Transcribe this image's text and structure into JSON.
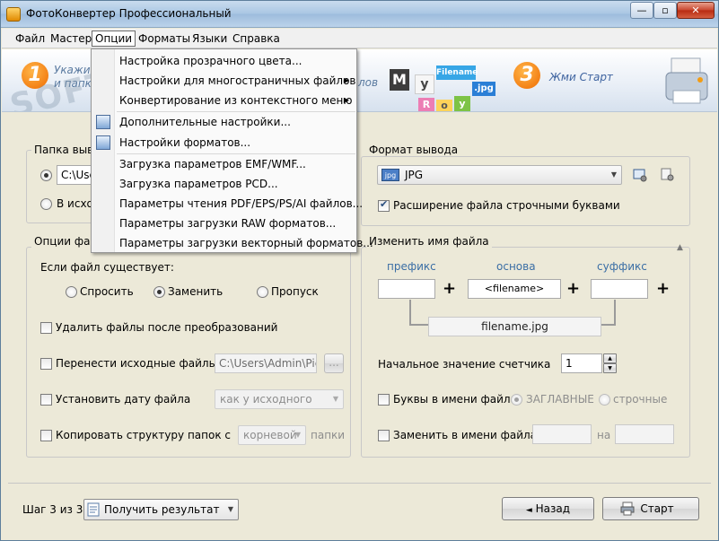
{
  "window": {
    "title": "ФотоКонвертер Профессиональный",
    "minimize": "—",
    "maximize": "▫",
    "close": "✕"
  },
  "menu": [
    "Файл",
    "Мастер",
    "Опции",
    "Форматы",
    "Языки",
    "Справка"
  ],
  "banner": {
    "step1": "1",
    "step1_text_line1": "Укажи",
    "step1_text_line2": "и папк",
    "step2_text": "лов",
    "step3": "3",
    "step3_text": "Жми Старт",
    "tiles": [
      "M",
      "y",
      "Filename",
      ".jpg",
      "R",
      "o",
      "y"
    ]
  },
  "options_menu": {
    "items": [
      {
        "label": "Настройка прозрачного цвета...",
        "submenu": false
      },
      {
        "label": "Настройки для многостраничных файлов",
        "submenu": true
      },
      {
        "label": "Конвертирование из контекстного меню",
        "submenu": true
      },
      {
        "label": "Дополнительные настройки...",
        "submenu": false
      },
      {
        "label": "Настройки форматов...",
        "submenu": false
      },
      {
        "label": "Загрузка параметров EMF/WMF...",
        "submenu": false
      },
      {
        "label": "Загрузка параметров PCD...",
        "submenu": false
      },
      {
        "label": "Параметры чтения PDF/EPS/PS/AI файлов...",
        "submenu": false
      },
      {
        "label": "Параметры загрузки RAW форматов...",
        "submenu": false
      },
      {
        "label": "Параметры загрузки векторный форматов...",
        "submenu": false
      }
    ]
  },
  "output_folder": {
    "title": "Папка выво",
    "path_value": "C:\\Use",
    "radio2_label": "В исходн"
  },
  "output_format": {
    "title": "Формат вывода",
    "format_value": "JPG",
    "format_icon_text": "jpg",
    "lowercase_ext_label": "Расширение файла строчными буквами",
    "lowercase_ext_checked": true
  },
  "file_options": {
    "title": "Опции фай",
    "if_exists_label": "Если файл существует:",
    "if_exists_options": [
      "Спросить",
      "Заменить",
      "Пропуск"
    ],
    "if_exists_selected": "Заменить",
    "delete_after_label": "Удалить файлы после преобразований",
    "move_sources_label": "Перенести исходные файлы",
    "move_path_value": "C:\\Users\\Admin\\Pic",
    "browse_label": "...",
    "set_date_label": "Установить дату файла",
    "set_date_value": "как у исходного",
    "copy_structure_label": "Копировать структуру папок с",
    "copy_structure_value": "корневой",
    "copy_structure_suffix": "папки"
  },
  "rename": {
    "title": "Изменить имя файла",
    "prefix_label": "префикс",
    "base_label": "основа",
    "suffix_label": "суффикс",
    "base_value": "<filename>",
    "preview": "filename.jpg",
    "plus": "+",
    "counter_label": "Начальное значение счетчика",
    "counter_value": "1",
    "letters_label": "Буквы в имени файла:",
    "letters_options": [
      "ЗАГЛАВНЫЕ",
      "строчные"
    ],
    "letters_selected": "ЗАГЛАВНЫЕ",
    "replace_label": "Заменить в имени файла",
    "replace_to_label": "на"
  },
  "footer": {
    "step_label": "Шаг 3 из 3:",
    "step_select_value": "Получить результат",
    "back_label": "Назад",
    "back_arrow": "◄",
    "start_label": "Старт"
  },
  "colors": {
    "accent_orange": "#ef6b00",
    "link_blue": "#3a6ea5",
    "window_bg": "#ece9d8"
  }
}
